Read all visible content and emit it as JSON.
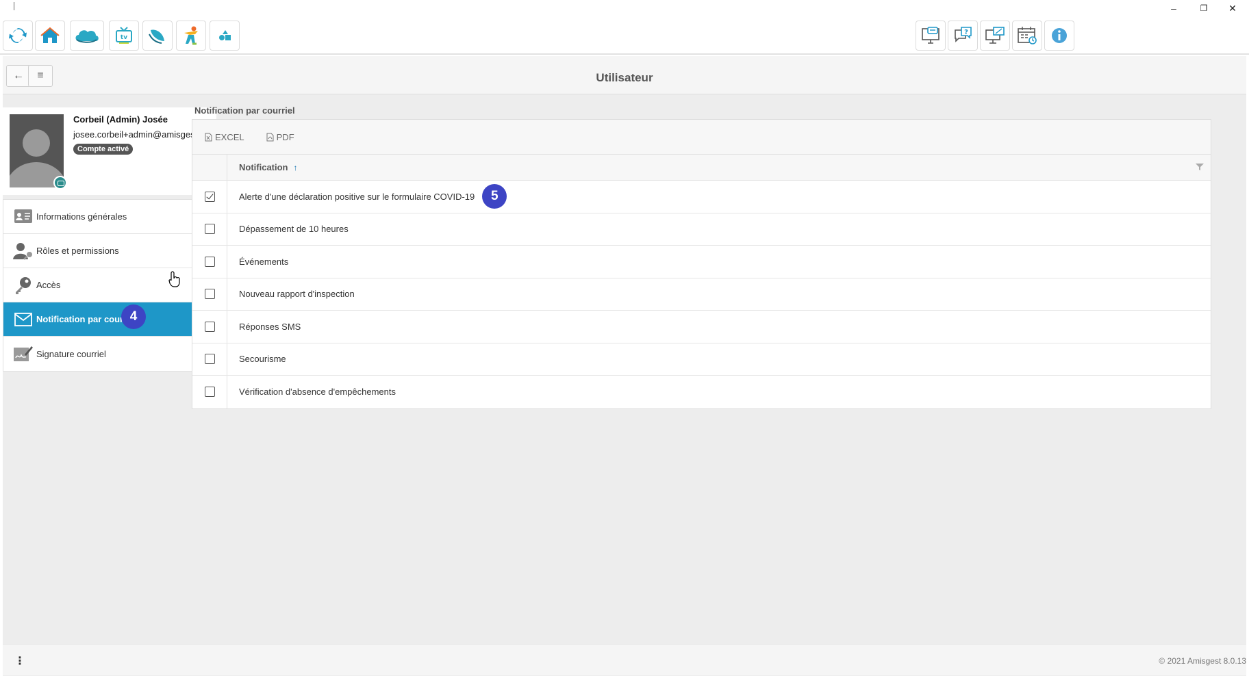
{
  "window": {
    "minimize": "–",
    "restore": "❐",
    "close": "✕"
  },
  "toolbar": {
    "left_buttons": [
      "refresh-icon",
      "home-icon",
      "cloud-icon",
      "tv-icon",
      "leaf-icon",
      "figure-icon",
      "shapes-icon"
    ],
    "right_buttons": [
      "monitor-chat-icon",
      "help-chat-icon",
      "monitor-sync-icon",
      "calendar-clock-icon",
      "info-icon"
    ]
  },
  "header": {
    "title": "Utilisateur",
    "back_icon": "←",
    "menu_icon": "≡"
  },
  "profile": {
    "name": "Corbeil (Admin) Josée",
    "email": "josee.corbeil+admin@amisgest.ca",
    "status_badge": "Compte activé"
  },
  "menu": {
    "items": [
      {
        "label": "Informations générales",
        "icon": "id-card-icon"
      },
      {
        "label": "Rôles et permissions",
        "icon": "user-key-icon"
      },
      {
        "label": "Accès",
        "icon": "key-icon"
      },
      {
        "label": "Notification par courriel",
        "icon": "envelope-icon",
        "active": true
      },
      {
        "label": "Signature courriel",
        "icon": "signature-icon"
      }
    ],
    "step_badge": "4"
  },
  "main": {
    "section_title": "Notification par courriel",
    "export_excel": "EXCEL",
    "export_pdf": "PDF",
    "column_header": "Notification",
    "sort_indicator": "↑",
    "rows": [
      {
        "label": "Alerte d'une déclaration positive sur le formulaire COVID-19",
        "checked": true
      },
      {
        "label": "Dépassement de 10 heures",
        "checked": false
      },
      {
        "label": "Événements",
        "checked": false
      },
      {
        "label": "Nouveau rapport d'inspection",
        "checked": false
      },
      {
        "label": "Réponses SMS",
        "checked": false
      },
      {
        "label": "Secourisme",
        "checked": false
      },
      {
        "label": "Vérification d'absence d'empêchements",
        "checked": false
      }
    ],
    "step_badge": "5"
  },
  "footer": {
    "kebab": "⋮",
    "copyright": "© 2021 Amisgest 8.0.13"
  },
  "colors": {
    "accent": "#1e97c8",
    "step_badge": "#3d44c4",
    "teal": "#2aa8c4"
  }
}
